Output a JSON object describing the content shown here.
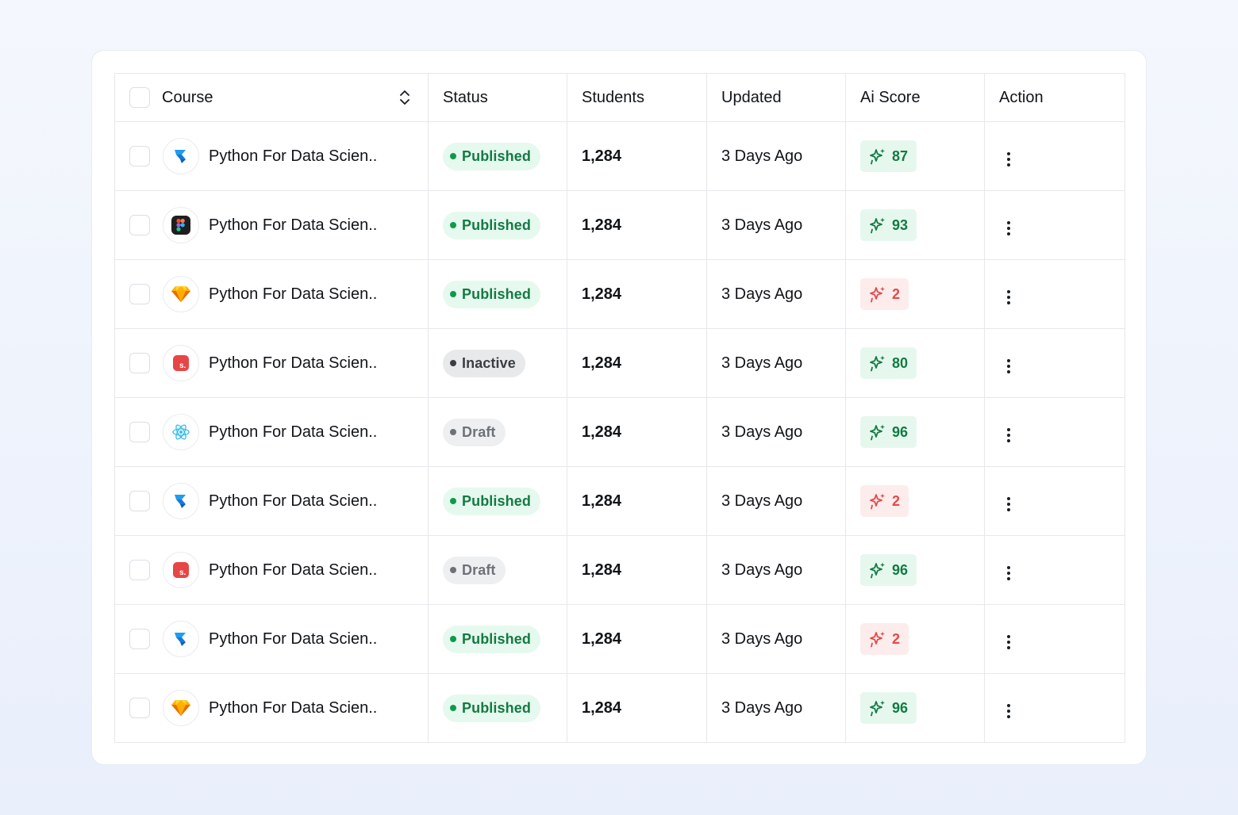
{
  "table": {
    "headers": {
      "course": "Course",
      "status": "Status",
      "students": "Students",
      "updated": "Updated",
      "ai_score": "Ai Score",
      "action": "Action"
    },
    "rows": [
      {
        "icon": "framer-icon",
        "name": "Python For Data Scien..",
        "status": "Published",
        "status_type": "published",
        "students": "1,284",
        "updated": "3 Days Ago",
        "ai_score": "87",
        "ai_level": "high"
      },
      {
        "icon": "figma-icon",
        "name": "Python For Data Scien..",
        "status": "Published",
        "status_type": "published",
        "students": "1,284",
        "updated": "3 Days Ago",
        "ai_score": "93",
        "ai_level": "high"
      },
      {
        "icon": "sketch-icon",
        "name": "Python For Data Scien..",
        "status": "Published",
        "status_type": "published",
        "students": "1,284",
        "updated": "3 Days Ago",
        "ai_score": "2",
        "ai_level": "low"
      },
      {
        "icon": "sendinblue-icon",
        "name": "Python For Data Scien..",
        "status": "Inactive",
        "status_type": "inactive",
        "students": "1,284",
        "updated": "3 Days Ago",
        "ai_score": "80",
        "ai_level": "high"
      },
      {
        "icon": "react-icon",
        "name": "Python For Data Scien..",
        "status": "Draft",
        "status_type": "draft",
        "students": "1,284",
        "updated": "3 Days Ago",
        "ai_score": "96",
        "ai_level": "high"
      },
      {
        "icon": "framer-icon",
        "name": "Python For Data Scien..",
        "status": "Published",
        "status_type": "published",
        "students": "1,284",
        "updated": "3 Days Ago",
        "ai_score": "2",
        "ai_level": "low"
      },
      {
        "icon": "sendinblue-icon",
        "name": "Python For Data Scien..",
        "status": "Draft",
        "status_type": "draft",
        "students": "1,284",
        "updated": "3 Days Ago",
        "ai_score": "96",
        "ai_level": "high"
      },
      {
        "icon": "framer-icon",
        "name": "Python For Data Scien..",
        "status": "Published",
        "status_type": "published",
        "students": "1,284",
        "updated": "3 Days Ago",
        "ai_score": "2",
        "ai_level": "low"
      },
      {
        "icon": "sketch-icon",
        "name": "Python For Data Scien..",
        "status": "Published",
        "status_type": "published",
        "students": "1,284",
        "updated": "3 Days Ago",
        "ai_score": "96",
        "ai_level": "high"
      }
    ]
  },
  "colors": {
    "published_bg": "#e6f9ee",
    "published_text": "#137a43",
    "ai_high": "#137a43",
    "ai_low": "#e24b4b",
    "border": "#e6e8ec"
  }
}
